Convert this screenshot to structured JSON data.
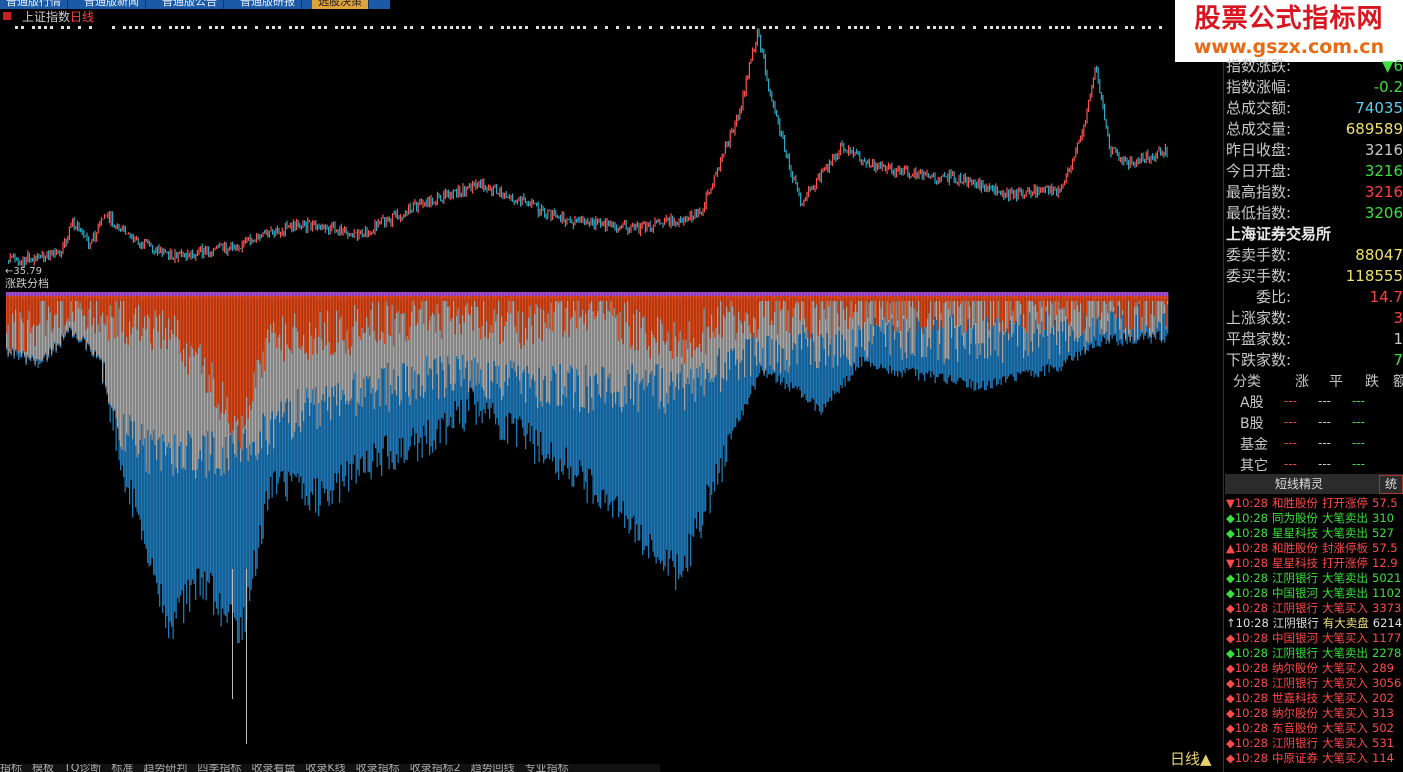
{
  "tabs": [
    "普通版行情",
    "普通版新闻",
    "普通版公告",
    "普通版研报",
    "选股决策"
  ],
  "chart": {
    "title": "上证指数",
    "period": "日线",
    "ref_label": "←35.79",
    "sub_label": "涨跌分档"
  },
  "logo": {
    "line1": "股票公式指标网",
    "line2": "www.gszx.com.cn"
  },
  "quotes": [
    {
      "label": "指数涨跌:",
      "value": "▼6",
      "color": "#3ce03c"
    },
    {
      "label": "指数涨幅:",
      "value": "-0.2",
      "color": "#3ce03c"
    },
    {
      "label": "总成交额:",
      "value": "74035",
      "color": "#5fd0f0"
    },
    {
      "label": "总成交量:",
      "value": "689589",
      "color": "#f0e070"
    },
    {
      "label": "昨日收盘:",
      "value": "3216",
      "color": "#c8c8c8"
    },
    {
      "label": "今日开盘:",
      "value": "3216",
      "color": "#3ce03c"
    },
    {
      "label": "最高指数:",
      "value": "3216",
      "color": "#ff4040"
    },
    {
      "label": "最低指数:",
      "value": "3206",
      "color": "#3ce03c"
    }
  ],
  "exchange": "上海证券交易所",
  "orders": [
    {
      "label": "委卖手数:",
      "value": "88047",
      "color": "#f0e070"
    },
    {
      "label": "委买手数:",
      "value": "118555",
      "color": "#f0e070"
    },
    {
      "label": "委比:",
      "value": "14.7",
      "color": "#ff4040"
    },
    {
      "label": "上涨家数:",
      "value": "3",
      "color": "#ff4040"
    },
    {
      "label": "平盘家数:",
      "value": "1",
      "color": "#c8c8c8"
    },
    {
      "label": "下跌家数:",
      "value": "7",
      "color": "#3ce03c"
    }
  ],
  "breakdown": {
    "headers": [
      "分类",
      "涨",
      "平",
      "跌",
      "额"
    ],
    "rows": [
      {
        "name": "A股",
        "v": [
          "---",
          "---",
          "---"
        ]
      },
      {
        "name": "B股",
        "v": [
          "---",
          "---",
          "---"
        ]
      },
      {
        "name": "基金",
        "v": [
          "---",
          "---",
          "---"
        ]
      },
      {
        "name": "其它",
        "v": [
          "---",
          "---",
          "---"
        ]
      }
    ]
  },
  "panel": {
    "title": "短线精灵",
    "button": "统"
  },
  "events": [
    {
      "icon": "▼",
      "time": "10:28",
      "name": "和胜股份",
      "act": "打开涨停",
      "val": "57.5",
      "c": "#ff4a4a"
    },
    {
      "icon": "◆",
      "time": "10:28",
      "name": "同为股份",
      "act": "大笔卖出",
      "val": "310",
      "c": "#3ce03c"
    },
    {
      "icon": "◆",
      "time": "10:28",
      "name": "星星科技",
      "act": "大笔卖出",
      "val": "527",
      "c": "#3ce03c"
    },
    {
      "icon": "▲",
      "time": "10:28",
      "name": "和胜股份",
      "act": "封涨停板",
      "val": "57.5",
      "c": "#ff4a4a"
    },
    {
      "icon": "▼",
      "time": "10:28",
      "name": "星星科技",
      "act": "打开涨停",
      "val": "12.9",
      "c": "#ff4a4a"
    },
    {
      "icon": "◆",
      "time": "10:28",
      "name": "江阴银行",
      "act": "大笔卖出",
      "val": "5021",
      "c": "#3ce03c"
    },
    {
      "icon": "◆",
      "time": "10:28",
      "name": "中国银河",
      "act": "大笔卖出",
      "val": "1102",
      "c": "#3ce03c"
    },
    {
      "icon": "◆",
      "time": "10:28",
      "name": "江阴银行",
      "act": "大笔买入",
      "val": "3373",
      "c": "#ff4a4a"
    },
    {
      "icon": "↑",
      "time": "10:28",
      "name": "江阴银行",
      "act": "有大卖盘",
      "val": "6214",
      "c": "#e0e0e0"
    },
    {
      "icon": "◆",
      "time": "10:28",
      "name": "中国银河",
      "act": "大笔买入",
      "val": "1177",
      "c": "#ff4a4a"
    },
    {
      "icon": "◆",
      "time": "10:28",
      "name": "江阴银行",
      "act": "大笔卖出",
      "val": "2278",
      "c": "#3ce03c"
    },
    {
      "icon": "◆",
      "time": "10:28",
      "name": "纳尔股份",
      "act": "大笔买入",
      "val": "289",
      "c": "#ff4a4a"
    },
    {
      "icon": "◆",
      "time": "10:28",
      "name": "江阴银行",
      "act": "大笔买入",
      "val": "3056",
      "c": "#ff4a4a"
    },
    {
      "icon": "◆",
      "time": "10:28",
      "name": "世嘉科技",
      "act": "大笔买入",
      "val": "202",
      "c": "#ff4a4a"
    },
    {
      "icon": "◆",
      "time": "10:28",
      "name": "纳尔股份",
      "act": "大笔买入",
      "val": "313",
      "c": "#ff4a4a"
    },
    {
      "icon": "◆",
      "time": "10:28",
      "name": "东音股份",
      "act": "大笔买入",
      "val": "502",
      "c": "#ff4a4a"
    },
    {
      "icon": "◆",
      "time": "10:28",
      "name": "江阴银行",
      "act": "大笔买入",
      "val": "531",
      "c": "#ff4a4a"
    },
    {
      "icon": "◆",
      "time": "10:28",
      "name": "中原证券",
      "act": "大笔买入",
      "val": "114",
      "c": "#ff4a4a"
    }
  ],
  "bottom_tabs": [
    "指标",
    "模板",
    "TQ诊断",
    "标准",
    "趋势研判",
    "四季指标",
    "收录看盘",
    "收录K线",
    "收录指标",
    "收录指标2",
    "趋势回线",
    "专业指标"
  ],
  "period_footer": "日线▲"
}
